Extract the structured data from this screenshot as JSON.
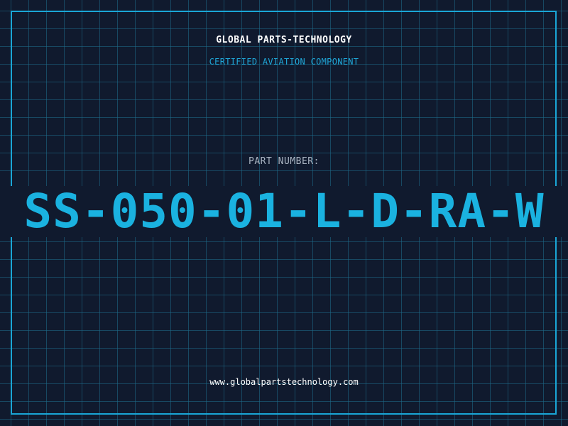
{
  "header": {
    "company": "GLOBAL PARTS-TECHNOLOGY",
    "tagline": "CERTIFIED AVIATION COMPONENT"
  },
  "part": {
    "label": "PART NUMBER:",
    "number": "SS-050-01-L-D-RA-W"
  },
  "footer": {
    "website": "www.globalpartstechnology.com"
  },
  "colors": {
    "background": "#101a2e",
    "grid": "#1e6e8c",
    "accent": "#1ab2e0",
    "frame": "#1aa6d6",
    "text": "#ffffff",
    "muted": "#a9b4c2"
  }
}
